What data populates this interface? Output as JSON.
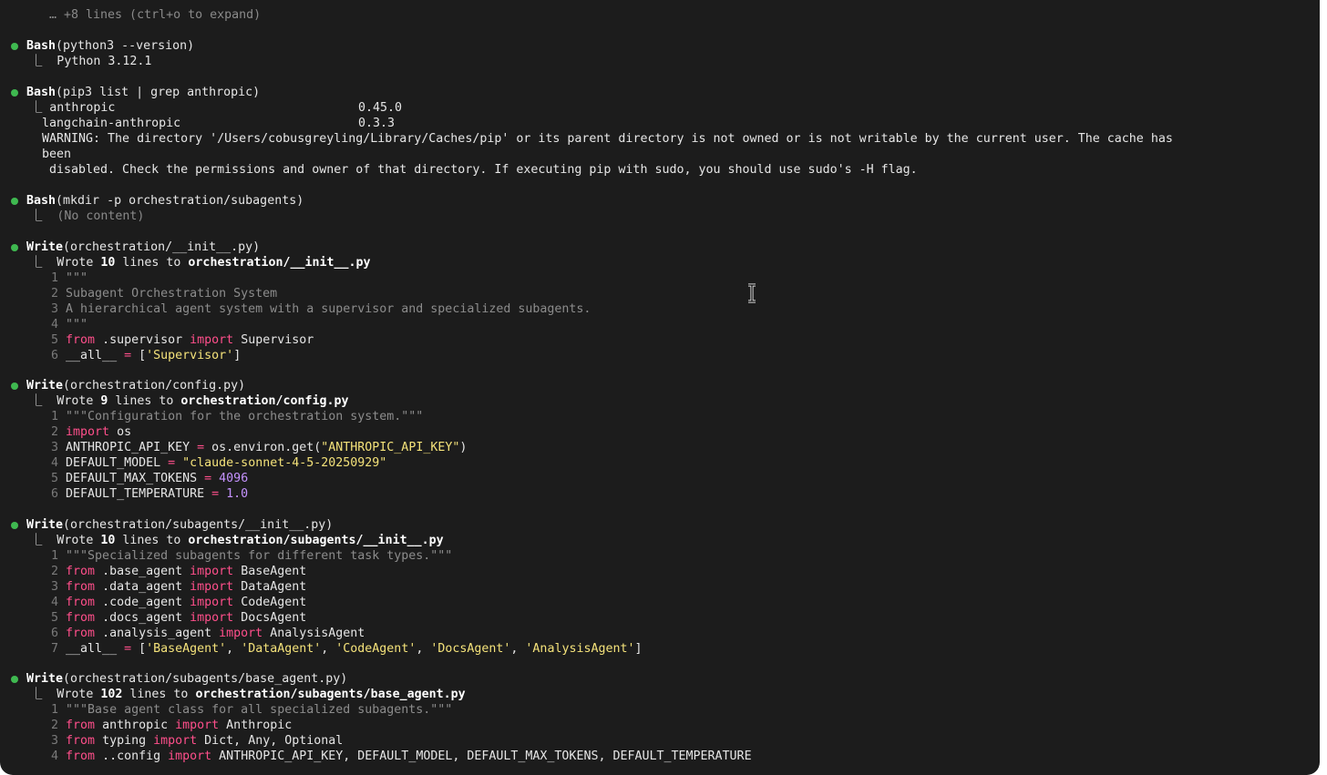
{
  "collapsed_hint": "… +8 lines (ctrl+o to expand)",
  "blocks": [
    {
      "tool": "Bash",
      "arg": "(python3 --version)",
      "output": [
        "Python 3.12.1"
      ]
    },
    {
      "tool": "Bash",
      "arg": "(pip3 list | grep anthropic)",
      "pkg1_name": "anthropic",
      "pkg1_ver": "0.45.0",
      "pkg2_name": "langchain-anthropic",
      "pkg2_ver": "0.3.3",
      "warn1": "WARNING: The directory '/Users/cobusgreyling/Library/Caches/pip' or its parent directory is not owned or is not writable by the current user. The cache has",
      "warn2": "been",
      "warn3": "disabled. Check the permissions and owner of that directory. If executing pip with sudo, you should use sudo's -H flag."
    },
    {
      "tool": "Bash",
      "arg": "(mkdir -p orchestration/subagents)",
      "output": [
        "(No content)"
      ]
    },
    {
      "tool": "Write",
      "arg": "(orchestration/__init__.py)",
      "count": "10",
      "path": "orchestration/__init__.py"
    },
    {
      "tool": "Write",
      "arg": "(orchestration/config.py)",
      "count": "9",
      "path": "orchestration/config.py"
    },
    {
      "tool": "Write",
      "arg": "(orchestration/subagents/__init__.py)",
      "count": "10",
      "path": "orchestration/subagents/__init__.py"
    },
    {
      "tool": "Write",
      "arg": "(orchestration/subagents/base_agent.py)",
      "count": "102",
      "path": "orchestration/subagents/base_agent.py"
    }
  ],
  "wrote_word": "Wrote",
  "lines_to": "lines to",
  "code": {
    "init": [
      "\"\"\"",
      "Subagent Orchestration System",
      "A hierarchical agent system with a supervisor and specialized subagents.",
      "\"\"\"",
      "from .supervisor import Supervisor",
      "__all__ = ['Supervisor']"
    ],
    "config": [
      "\"\"\"Configuration for the orchestration system.\"\"\"",
      "import os",
      "ANTHROPIC_API_KEY = os.environ.get(\"ANTHROPIC_API_KEY\")",
      "DEFAULT_MODEL = \"claude-sonnet-4-5-20250929\"",
      "DEFAULT_MAX_TOKENS = 4096",
      "DEFAULT_TEMPERATURE = 1.0"
    ],
    "subinit": [
      "\"\"\"Specialized subagents for different task types.\"\"\"",
      "from .base_agent import BaseAgent",
      "from .data_agent import DataAgent",
      "from .code_agent import CodeAgent",
      "from .docs_agent import DocsAgent",
      "from .analysis_agent import AnalysisAgent",
      "__all__ = ['BaseAgent', 'DataAgent', 'CodeAgent', 'DocsAgent', 'AnalysisAgent']"
    ],
    "base": [
      "\"\"\"Base agent class for all specialized subagents.\"\"\"",
      "from anthropic import Anthropic",
      "from typing import Dict, Any, Optional",
      "from ..config import ANTHROPIC_API_KEY, DEFAULT_MODEL, DEFAULT_MAX_TOKENS, DEFAULT_TEMPERATURE"
    ]
  },
  "colors": {
    "background": "#1c1c1c",
    "bullet": "#3fb950",
    "keyword": "#ff4f8b",
    "string": "#f4e27a",
    "number": "#c592ff",
    "comment": "#8c8c8c"
  }
}
